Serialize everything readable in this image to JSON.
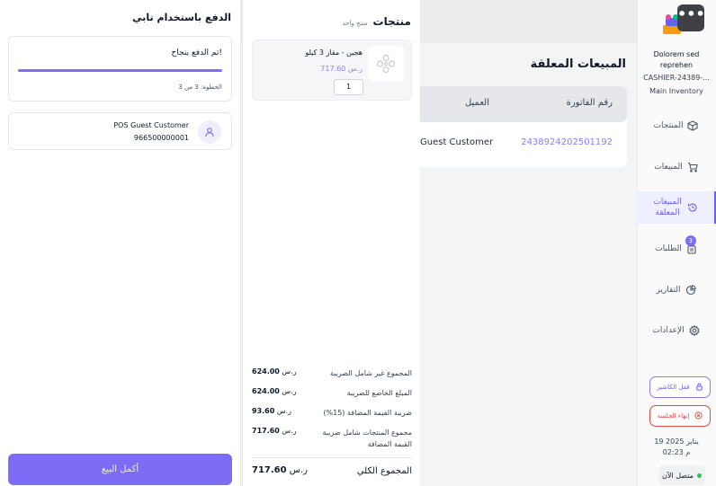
{
  "sidebar": {
    "menu_button": "•••",
    "user": {
      "name": "Dolorem sed reprehen",
      "cashier_id": "CASHIER-24389-...",
      "inventory": "Main Inventory"
    },
    "items": [
      {
        "label": "المنتجات",
        "icon": "box-icon"
      },
      {
        "label": "المبيعات",
        "icon": "cart-icon"
      },
      {
        "label": "المبيعات المعلقة",
        "icon": "history-icon",
        "active": true
      },
      {
        "label": "الطلبات",
        "icon": "orders-icon",
        "badge": "3"
      },
      {
        "label": "التقارير",
        "icon": "pie-chart-icon"
      },
      {
        "label": "الإعدادات",
        "icon": "gear-icon"
      }
    ],
    "lock_label": "قفل الكاشير",
    "end_session_label": "إنهاء الجلسة",
    "date": "19 يناير 2025",
    "time": "02:23 م",
    "status": "متصل الآن"
  },
  "main": {
    "title": "المبيعات المعلقة",
    "columns": {
      "invoice": "رقم الفاتورة",
      "customer": "العميل"
    },
    "row": {
      "invoice": "2438924202501192",
      "customer": "Guest Customer"
    }
  },
  "products": {
    "title": "منتجات",
    "subtitle": "منتج واحد",
    "item": {
      "name": "هجين - مقاز 3 كيلو",
      "price": "717.60 ر.س",
      "qty": "1"
    },
    "summary": {
      "subtotal_label": "المجموع غير شامل الضريبة",
      "subtotal_value": "624.00",
      "taxable_label": "المبلغ الخاضع للضريبة",
      "taxable_value": "624.00",
      "vat_label": "ضريبة القيمة المضافة (15%)",
      "vat_value": "93.60",
      "incl_label": "مجموع المنتجات شامل ضريبة القيمة المضافة",
      "incl_value": "717.60",
      "total_label": "المجموع الكلي",
      "total_value": "717.60",
      "currency": "ر.س"
    }
  },
  "payment": {
    "title": "الدفع باستخدام تابي",
    "status": "تم الدفع بنجاح!",
    "progress": 1.0,
    "step": "الخطوة: 3 من 3",
    "customer_name": "POS Guest Customer",
    "customer_phone": "966500000001",
    "complete_button": "أكمل البيع"
  },
  "colors": {
    "accent": "#7c6cf6",
    "danger": "#ef4444",
    "online": "#22c55e"
  }
}
